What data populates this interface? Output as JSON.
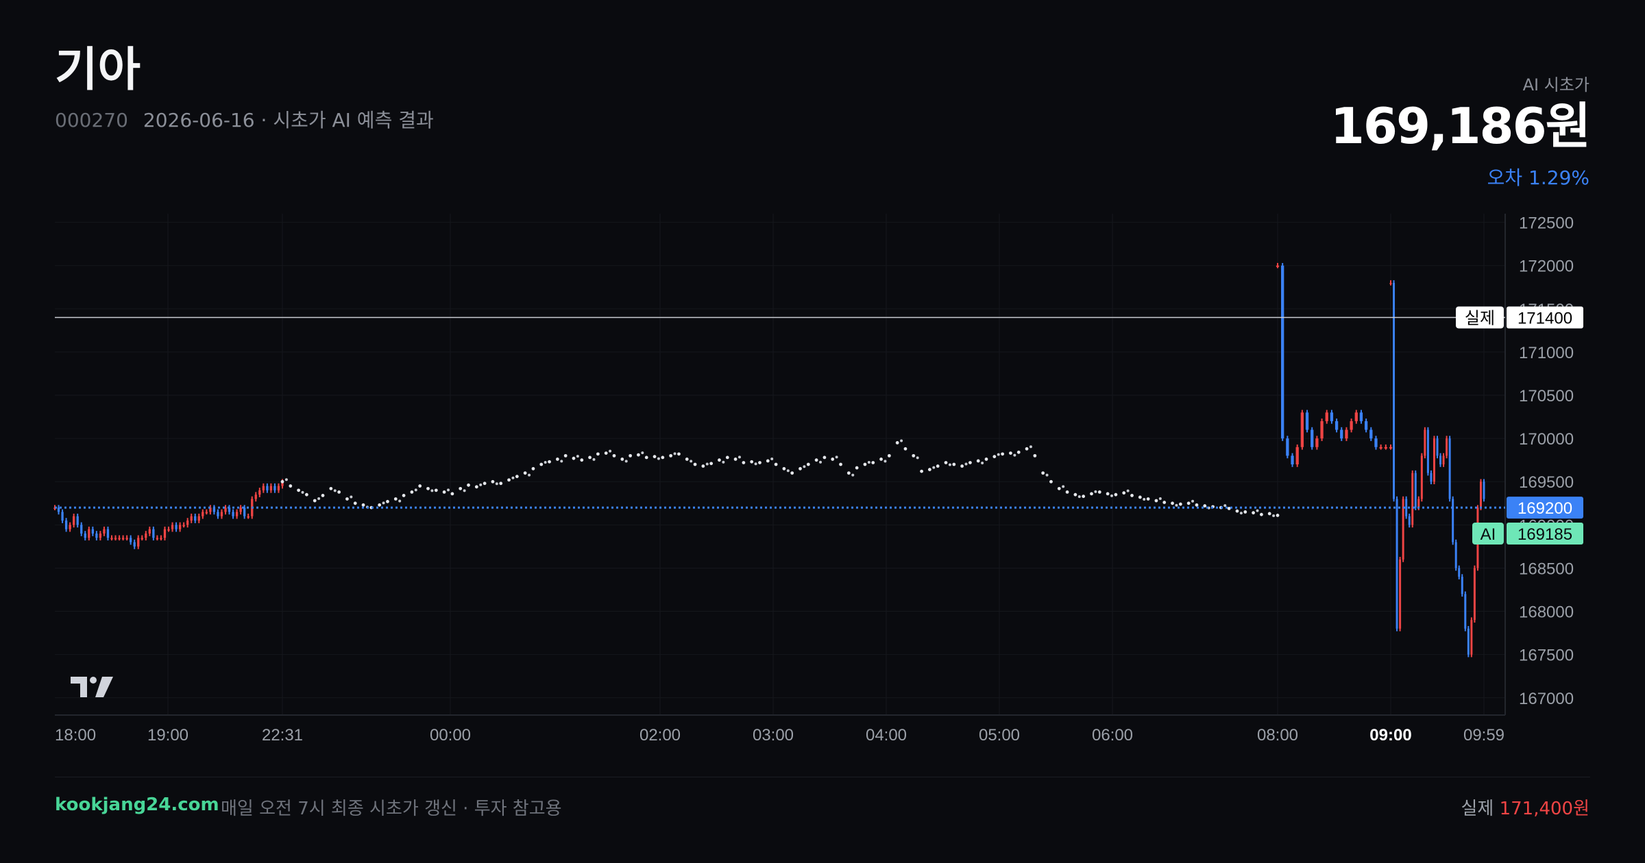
{
  "header": {
    "stock_name": "기아",
    "stock_code": "000270",
    "subtitle": "2026-06-16 · 시초가 AI 예측 결과"
  },
  "prediction": {
    "label": "AI 시초가",
    "value_text": "169,186원",
    "error_text": "오차 1.29%"
  },
  "footer": {
    "brand": "kookjang24.com",
    "note": "매일 오전 7시 최종 시초가 갱신 · 투자 참고용",
    "actual_label": "실제",
    "actual_value": "171,400원"
  },
  "colors": {
    "background": "#0a0b0f",
    "up": "#ef4444",
    "down": "#3b82f6",
    "ai_tag": "#6ee7b7",
    "current_tag": "#3b82f6",
    "error_text": "#3b82f6",
    "brand": "#48d597"
  },
  "icons": {
    "tradingview_logo": "tradingview-logo-icon"
  },
  "chart_data": {
    "type": "line",
    "y_ticks": [
      172500,
      172000,
      171500,
      171000,
      170500,
      170000,
      169500,
      169000,
      168500,
      168000,
      167500,
      167000
    ],
    "ylim": [
      166800,
      172600
    ],
    "x_ticks": [
      "18:00",
      "19:00",
      "22:31",
      "00:00",
      "02:00",
      "03:00",
      "04:00",
      "05:00",
      "06:00",
      "08:00",
      "09:00",
      "09:59"
    ],
    "x_ticks_bold": [
      "09:00"
    ],
    "reference_lines": [
      {
        "name": "실제",
        "value": 171400,
        "label": "171400",
        "style": "solid"
      },
      {
        "name": "",
        "value": 169200,
        "label": "169200",
        "style": "dotted"
      },
      {
        "name": "AI",
        "value": 169185,
        "label": "169185",
        "style": "none"
      }
    ],
    "segments": [
      {
        "name": "pre-session candles",
        "kind": "candles",
        "x_range": [
          "18:00",
          "22:31"
        ],
        "values": [
          169200,
          169150,
          169050,
          168950,
          169000,
          169100,
          169000,
          168900,
          168850,
          168950,
          168900,
          168850,
          168900,
          168950,
          168850,
          168850,
          168850,
          168850,
          168850,
          168850,
          168800,
          168750,
          168850,
          168850,
          168900,
          168950,
          168850,
          168850,
          168850,
          168950,
          168950,
          169000,
          168950,
          169000,
          169000,
          169050,
          169100,
          169050,
          169100,
          169150,
          169150,
          169200,
          169150,
          169100,
          169150,
          169200,
          169150,
          169100,
          169150,
          169200,
          169100,
          169100,
          169300,
          169350,
          169400,
          169450,
          169400,
          169450,
          169400,
          169450,
          169500
        ]
      },
      {
        "name": "overnight dotted trace",
        "kind": "dots",
        "x_range": [
          "22:31",
          "08:00"
        ],
        "values": [
          169500,
          169450,
          169400,
          169350,
          169280,
          169340,
          169420,
          169380,
          169300,
          169250,
          169230,
          169200,
          169230,
          169270,
          169300,
          169340,
          169380,
          169450,
          169420,
          169400,
          169380,
          169360,
          169420,
          169460,
          169440,
          169480,
          169500,
          169480,
          169520,
          169560,
          169600,
          169650,
          169700,
          169730,
          169760,
          169800,
          169770,
          169750,
          169780,
          169820,
          169830,
          169800,
          169760,
          169800,
          169810,
          169780,
          169790,
          169780,
          169800,
          169820,
          169760,
          169700,
          169680,
          169710,
          169750,
          169780,
          169760,
          169720,
          169730,
          169720,
          169740,
          169700,
          169650,
          169600,
          169650,
          169700,
          169750,
          169780,
          169760,
          169700,
          169600,
          169660,
          169700,
          169720,
          169760,
          169800,
          169950,
          169880,
          169800,
          169620,
          169640,
          169680,
          169720,
          169700,
          169680,
          169720,
          169740,
          169760,
          169790,
          169820,
          169830,
          169840,
          169880,
          169800,
          169600,
          169500,
          169420,
          169380,
          169350,
          169330,
          169360,
          169380,
          169360,
          169350,
          169370,
          169340,
          169320,
          169300,
          169280,
          169260,
          169250,
          169240,
          169250,
          169230,
          169220,
          169210,
          169200,
          169190,
          169160,
          169150,
          169140,
          169120,
          169130,
          169110
        ]
      },
      {
        "name": "pre-market candles",
        "kind": "candles",
        "x_range": [
          "08:00",
          "09:00"
        ],
        "values": [
          172000,
          170000,
          169800,
          169700,
          169900,
          170300,
          170100,
          169900,
          170000,
          170200,
          170300,
          170200,
          170100,
          170000,
          170100,
          170200,
          170300,
          170200,
          170100,
          170000,
          169900,
          169900,
          169900,
          169900
        ]
      },
      {
        "name": "market-open candles",
        "kind": "candles",
        "x_range": [
          "09:00",
          "09:59"
        ],
        "values": [
          171800,
          169300,
          167800,
          168600,
          169300,
          169100,
          169000,
          169600,
          169200,
          169300,
          169800,
          170100,
          169600,
          169500,
          170000,
          169800,
          169700,
          169800,
          170000,
          169300,
          168800,
          168500,
          168400,
          168200,
          167800,
          167500,
          167900,
          168500,
          169200,
          169500,
          169300
        ]
      }
    ],
    "grid": true,
    "legend": "none"
  }
}
